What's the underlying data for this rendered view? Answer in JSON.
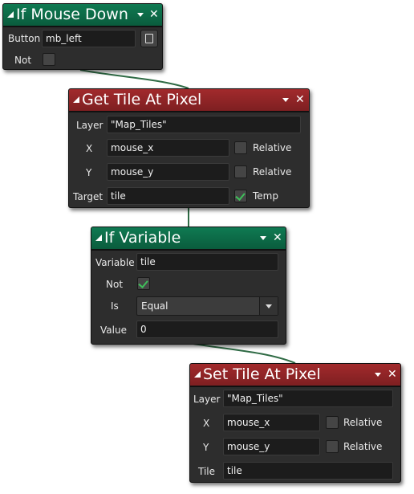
{
  "nodes": {
    "mouse_down": {
      "title": "If Mouse Down",
      "button_label": "Button",
      "button_value": "mb_left",
      "not_label": "Not",
      "not_checked": false
    },
    "get_tile": {
      "title": "Get Tile At Pixel",
      "layer_label": "Layer",
      "layer_value": "\"Map_Tiles\"",
      "x_label": "X",
      "x_value": "mouse_x",
      "x_relative_label": "Relative",
      "y_label": "Y",
      "y_value": "mouse_y",
      "y_relative_label": "Relative",
      "target_label": "Target",
      "target_value": "tile",
      "temp_label": "Temp",
      "temp_checked": true
    },
    "if_variable": {
      "title": "If Variable",
      "variable_label": "Variable",
      "variable_value": "tile",
      "not_label": "Not",
      "not_checked": true,
      "is_label": "Is",
      "is_value": "Equal",
      "value_label": "Value",
      "value_value": "0"
    },
    "set_tile": {
      "title": "Set Tile At Pixel",
      "layer_label": "Layer",
      "layer_value": "\"Map_Tiles\"",
      "x_label": "X",
      "x_value": "mouse_x",
      "x_relative_label": "Relative",
      "y_label": "Y",
      "y_value": "mouse_y",
      "y_relative_label": "Relative",
      "tile_label": "Tile",
      "tile_value": "tile"
    }
  },
  "icons": {
    "header_collapse": "collapse-triangle-icon",
    "header_menu": "chevron-down-icon",
    "header_close": "close-icon",
    "check": "checkmark-icon",
    "button_menu": "list-menu-icon"
  },
  "colors": {
    "condition_header": "#0a5c3d",
    "action_header": "#7e1f21",
    "node_body": "#2d2d2d",
    "field_bg": "#1c1c1c",
    "connector": "#2f6b45",
    "check": "#3fbf5a"
  }
}
